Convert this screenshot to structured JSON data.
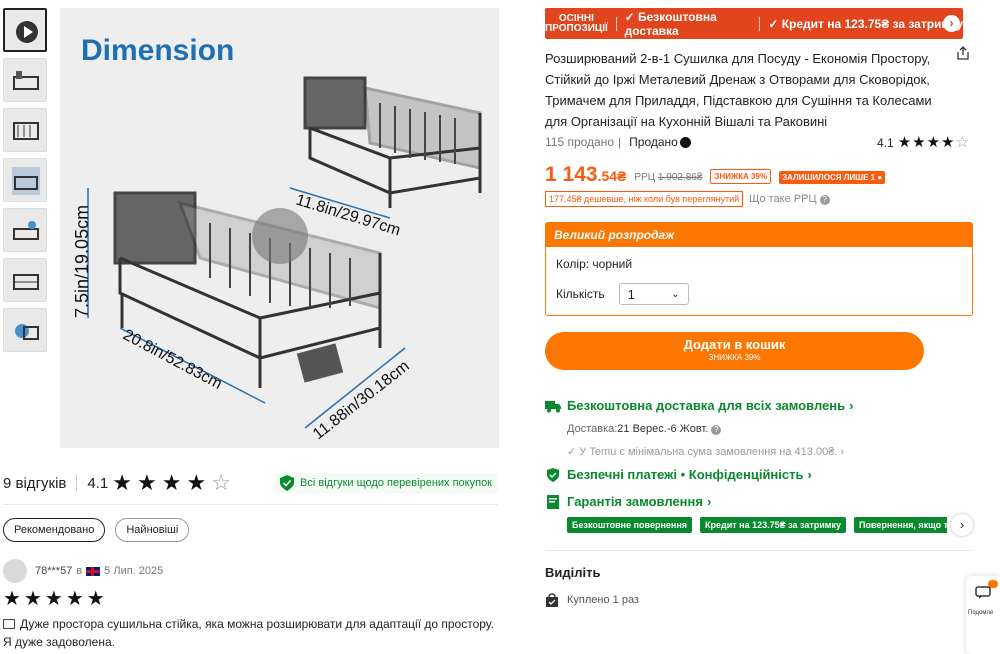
{
  "gallery": {
    "image_title": "Dimension",
    "dim_depth": "7.5in/19.05cm",
    "dim_width_small": "11.8in/29.97cm",
    "dim_width_large": "20.8in/52.83cm",
    "dim_length": "11.88in/30.18cm",
    "thumbnail_count": 7
  },
  "reviews": {
    "count_label": "9 відгуків",
    "rating": "4.1",
    "stars": [
      1,
      1,
      1,
      1,
      0
    ],
    "verified_label": "Всі відгуки щодо перевірених покупок",
    "filters": [
      "Рекомендовано",
      "Найновіші"
    ],
    "first": {
      "user": "78***57",
      "in_label": "в",
      "date": "5 Лип. 2025",
      "stars": [
        1,
        1,
        1,
        1,
        1
      ],
      "text": "Дуже простора сушильна стійка, яка можна розширювати для адаптації до простору. Я дуже задоволена."
    }
  },
  "banner": {
    "season_line1": "ОСІННІ",
    "season_line2": "ПРОПОЗИЦІЇ",
    "free_shipping": "✓ Безкоштовна доставка",
    "credit": "✓ Кредит на 123.75₴ за затримку"
  },
  "product": {
    "title": "Розширюваний 2-в-1 Сушилка для Посуду - Економія Простору, Стійкий до Іржі Металевий Дренаж з Отворами для Сковорідок, Тримачем для Приладдя, Підставкою для Сушіння та Колесами для Організації на Кухонній Вішалі та Раковині",
    "sold": "115 продано",
    "sold_by": "Продано",
    "rating": "4.1",
    "stars": [
      1,
      1,
      1,
      1,
      0
    ],
    "price_main": "1 143",
    "price_frac": ".54₴",
    "rrp_label": "РРЦ",
    "rrp_price": "1 902.86₴",
    "discount_tag": "ЗНИЖКА 39%",
    "left_tag": "ЗАЛИШИЛОСЯ ЛИШЕ 1",
    "cheaper": "177.45₴ дешевше, ніж коли був переглянутий",
    "what_rrp": "Що таке РРЦ"
  },
  "sale": {
    "header": "Великий розпродаж",
    "color_label": "Колір: чорний",
    "qty_label": "Кількість",
    "qty_value": "1"
  },
  "cart": {
    "label": "Додати в кошик",
    "sub": "ЗНИЖКА 39%"
  },
  "shipping": {
    "title": "Безкоштовна доставка для всіх замовлень",
    "delivery_label": "Доставка:",
    "delivery_dates": "21 Верес.-6 Жовт.",
    "min_order": "У Temu є мінімальна сума замовлення на 413.00₴."
  },
  "security": {
    "title": "Безпечні платежі • Конфіденційність"
  },
  "guarantee": {
    "title": "Гарантія замовлення",
    "tags": [
      "Безкоштовне повернення",
      "Кредит на 123.75₴ за затримку",
      "Повернення, якщо то"
    ]
  },
  "highlights": {
    "title": "Виділіть",
    "bought": "Куплено 1 раз"
  },
  "side": {
    "label": "Подомле"
  },
  "colors": {
    "accent": "#fb7701",
    "price": "#fb5a0f",
    "banner": "#e0451e",
    "green": "#0a8a2e",
    "dimension_blue": "#1f6fb5"
  }
}
